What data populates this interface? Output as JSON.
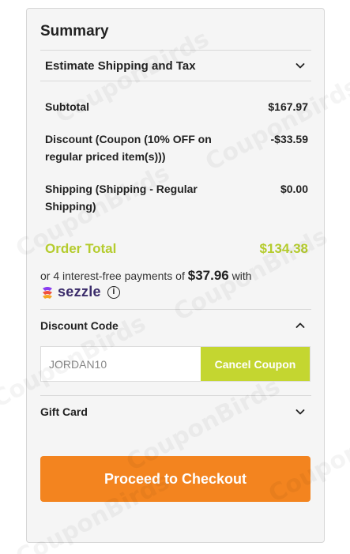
{
  "summary": {
    "title": "Summary",
    "estimate_label": "Estimate Shipping and Tax",
    "subtotal": {
      "label": "Subtotal",
      "value": "$167.97"
    },
    "discount": {
      "label": "Discount (Coupon (10% OFF on regular priced item(s)))",
      "value": "-$33.59"
    },
    "shipping": {
      "label": "Shipping (Shipping - Regular Shipping)",
      "value": "$0.00"
    },
    "order_total": {
      "label": "Order Total",
      "value": "$134.38"
    }
  },
  "sezzle": {
    "prefix": "or 4 interest-free payments of",
    "amount": "$37.96",
    "suffix": "with",
    "brand": "sezzle",
    "info_glyph": "i"
  },
  "discount_code": {
    "label": "Discount Code",
    "input_value": "JORDAN10",
    "cancel_label": "Cancel Coupon"
  },
  "gift_card": {
    "label": "Gift Card"
  },
  "checkout": {
    "label": "Proceed to Checkout"
  },
  "watermark_text": "CouponBirds",
  "colors": {
    "accent_green": "#c4d630",
    "total_green": "#b5cc2e",
    "checkout_orange": "#f3841f"
  }
}
